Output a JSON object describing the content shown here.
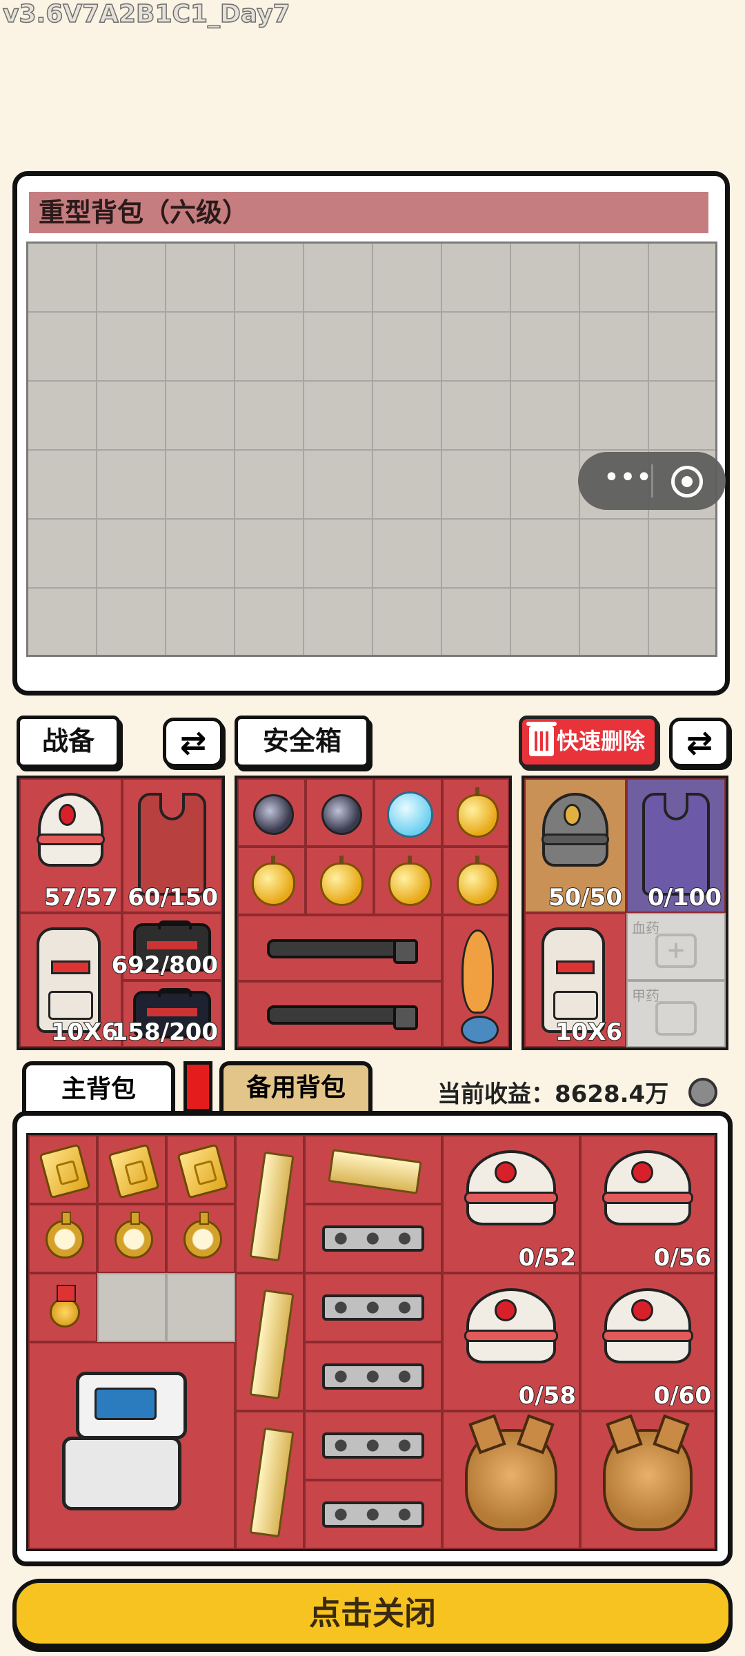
{
  "version": "v3.6V7A2B1C1_Day7",
  "backpack_panel": {
    "title": "重型背包（六级）"
  },
  "mini_program": {
    "more": "•••"
  },
  "loadout": {
    "gear_tab": "战备",
    "safe_tab": "安全箱",
    "quick_delete": "快速删除",
    "swap_symbol": "⇄",
    "left_counts": {
      "helmet": "57/57",
      "vest": "60/150",
      "pack": "10X6",
      "box_red": "692/800",
      "box_black": "158/200"
    },
    "right_counts": {
      "helmet": "50/50",
      "vest": "0/100",
      "pack": "10X6"
    },
    "right_labels": {
      "medicine": "血药",
      "armor": "甲药"
    }
  },
  "tabs": {
    "main": "主背包",
    "alt": "备用背包"
  },
  "earnings": {
    "label": "当前收益：",
    "value": "8628.4万"
  },
  "main_pack": {
    "helmet_counts": [
      "0/52",
      "0/56",
      "0/58",
      "0/60"
    ]
  },
  "close_button": "点击关闭",
  "colors": {
    "background": "#fbf3e3",
    "inventory_red": "#c8464a",
    "title_bar": "#c67d80",
    "close_yellow": "#f6c320",
    "delete_red": "#e8333b"
  }
}
